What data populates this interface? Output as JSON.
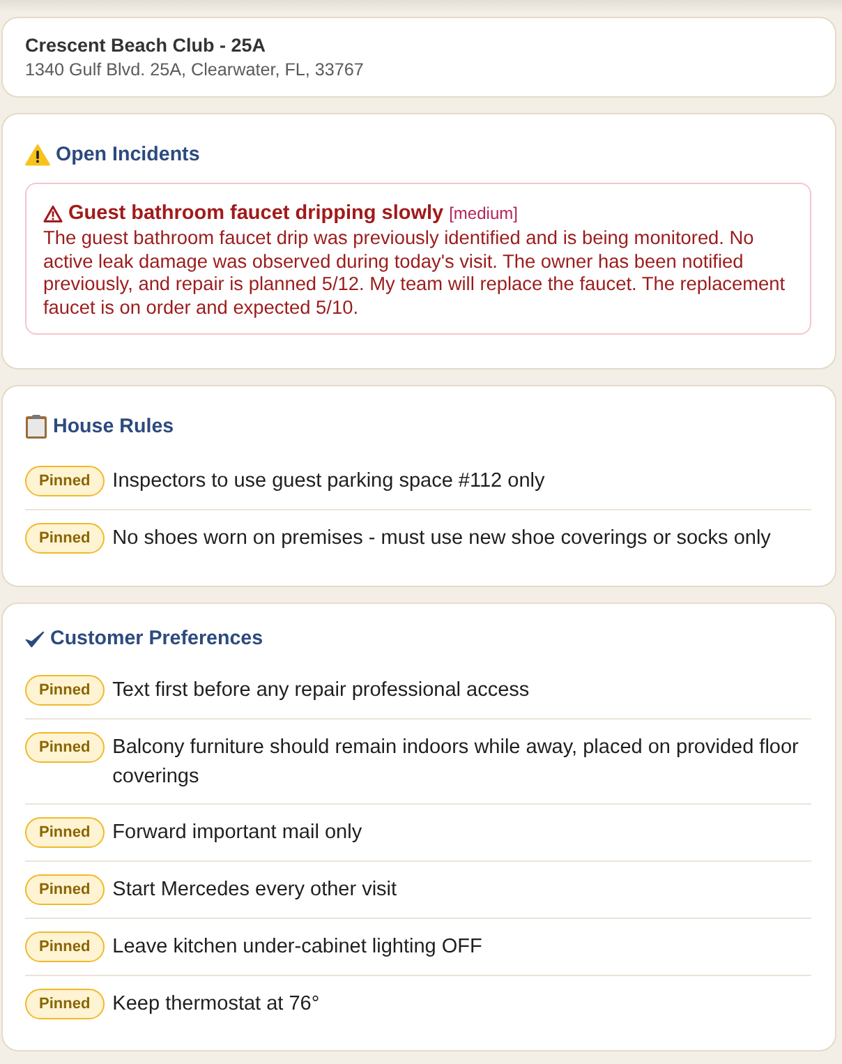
{
  "property": {
    "name": "Crescent Beach Club - 25A",
    "address": "1340 Gulf Blvd. 25A, Clearwater, FL, 33767"
  },
  "sections": [
    {
      "kind": "incidents",
      "title": "Open Incidents",
      "incidents": [
        {
          "title": "Guest bathroom faucet dripping slowly",
          "severity": "[medium]",
          "description": "The guest bathroom faucet drip was previously identified and is being monitored. No active leak damage was observed during today's visit. The owner has been notified previously, and repair is planned 5/12. My team will replace the faucet. The replacement faucet is on order and expected 5/10."
        }
      ]
    },
    {
      "kind": "rules",
      "title": "House Rules",
      "items": [
        {
          "badge": "Pinned",
          "text": "Inspectors to use guest parking space #112 only"
        },
        {
          "badge": "Pinned",
          "text": "No shoes worn on premises - must use new shoe coverings or socks only"
        }
      ]
    },
    {
      "kind": "preferences",
      "title": "Customer Preferences",
      "items": [
        {
          "badge": "Pinned",
          "text": "Text first before any repair professional access"
        },
        {
          "badge": "Pinned",
          "text": "Balcony furniture should remain indoors while away, placed on provided floor coverings"
        },
        {
          "badge": "Pinned",
          "text": "Forward important mail only"
        },
        {
          "badge": "Pinned",
          "text": "Start Mercedes every other visit"
        },
        {
          "badge": "Pinned",
          "text": "Leave kitchen under-cabinet lighting OFF"
        },
        {
          "badge": "Pinned",
          "text": "Keep thermostat at 76°"
        }
      ]
    }
  ]
}
